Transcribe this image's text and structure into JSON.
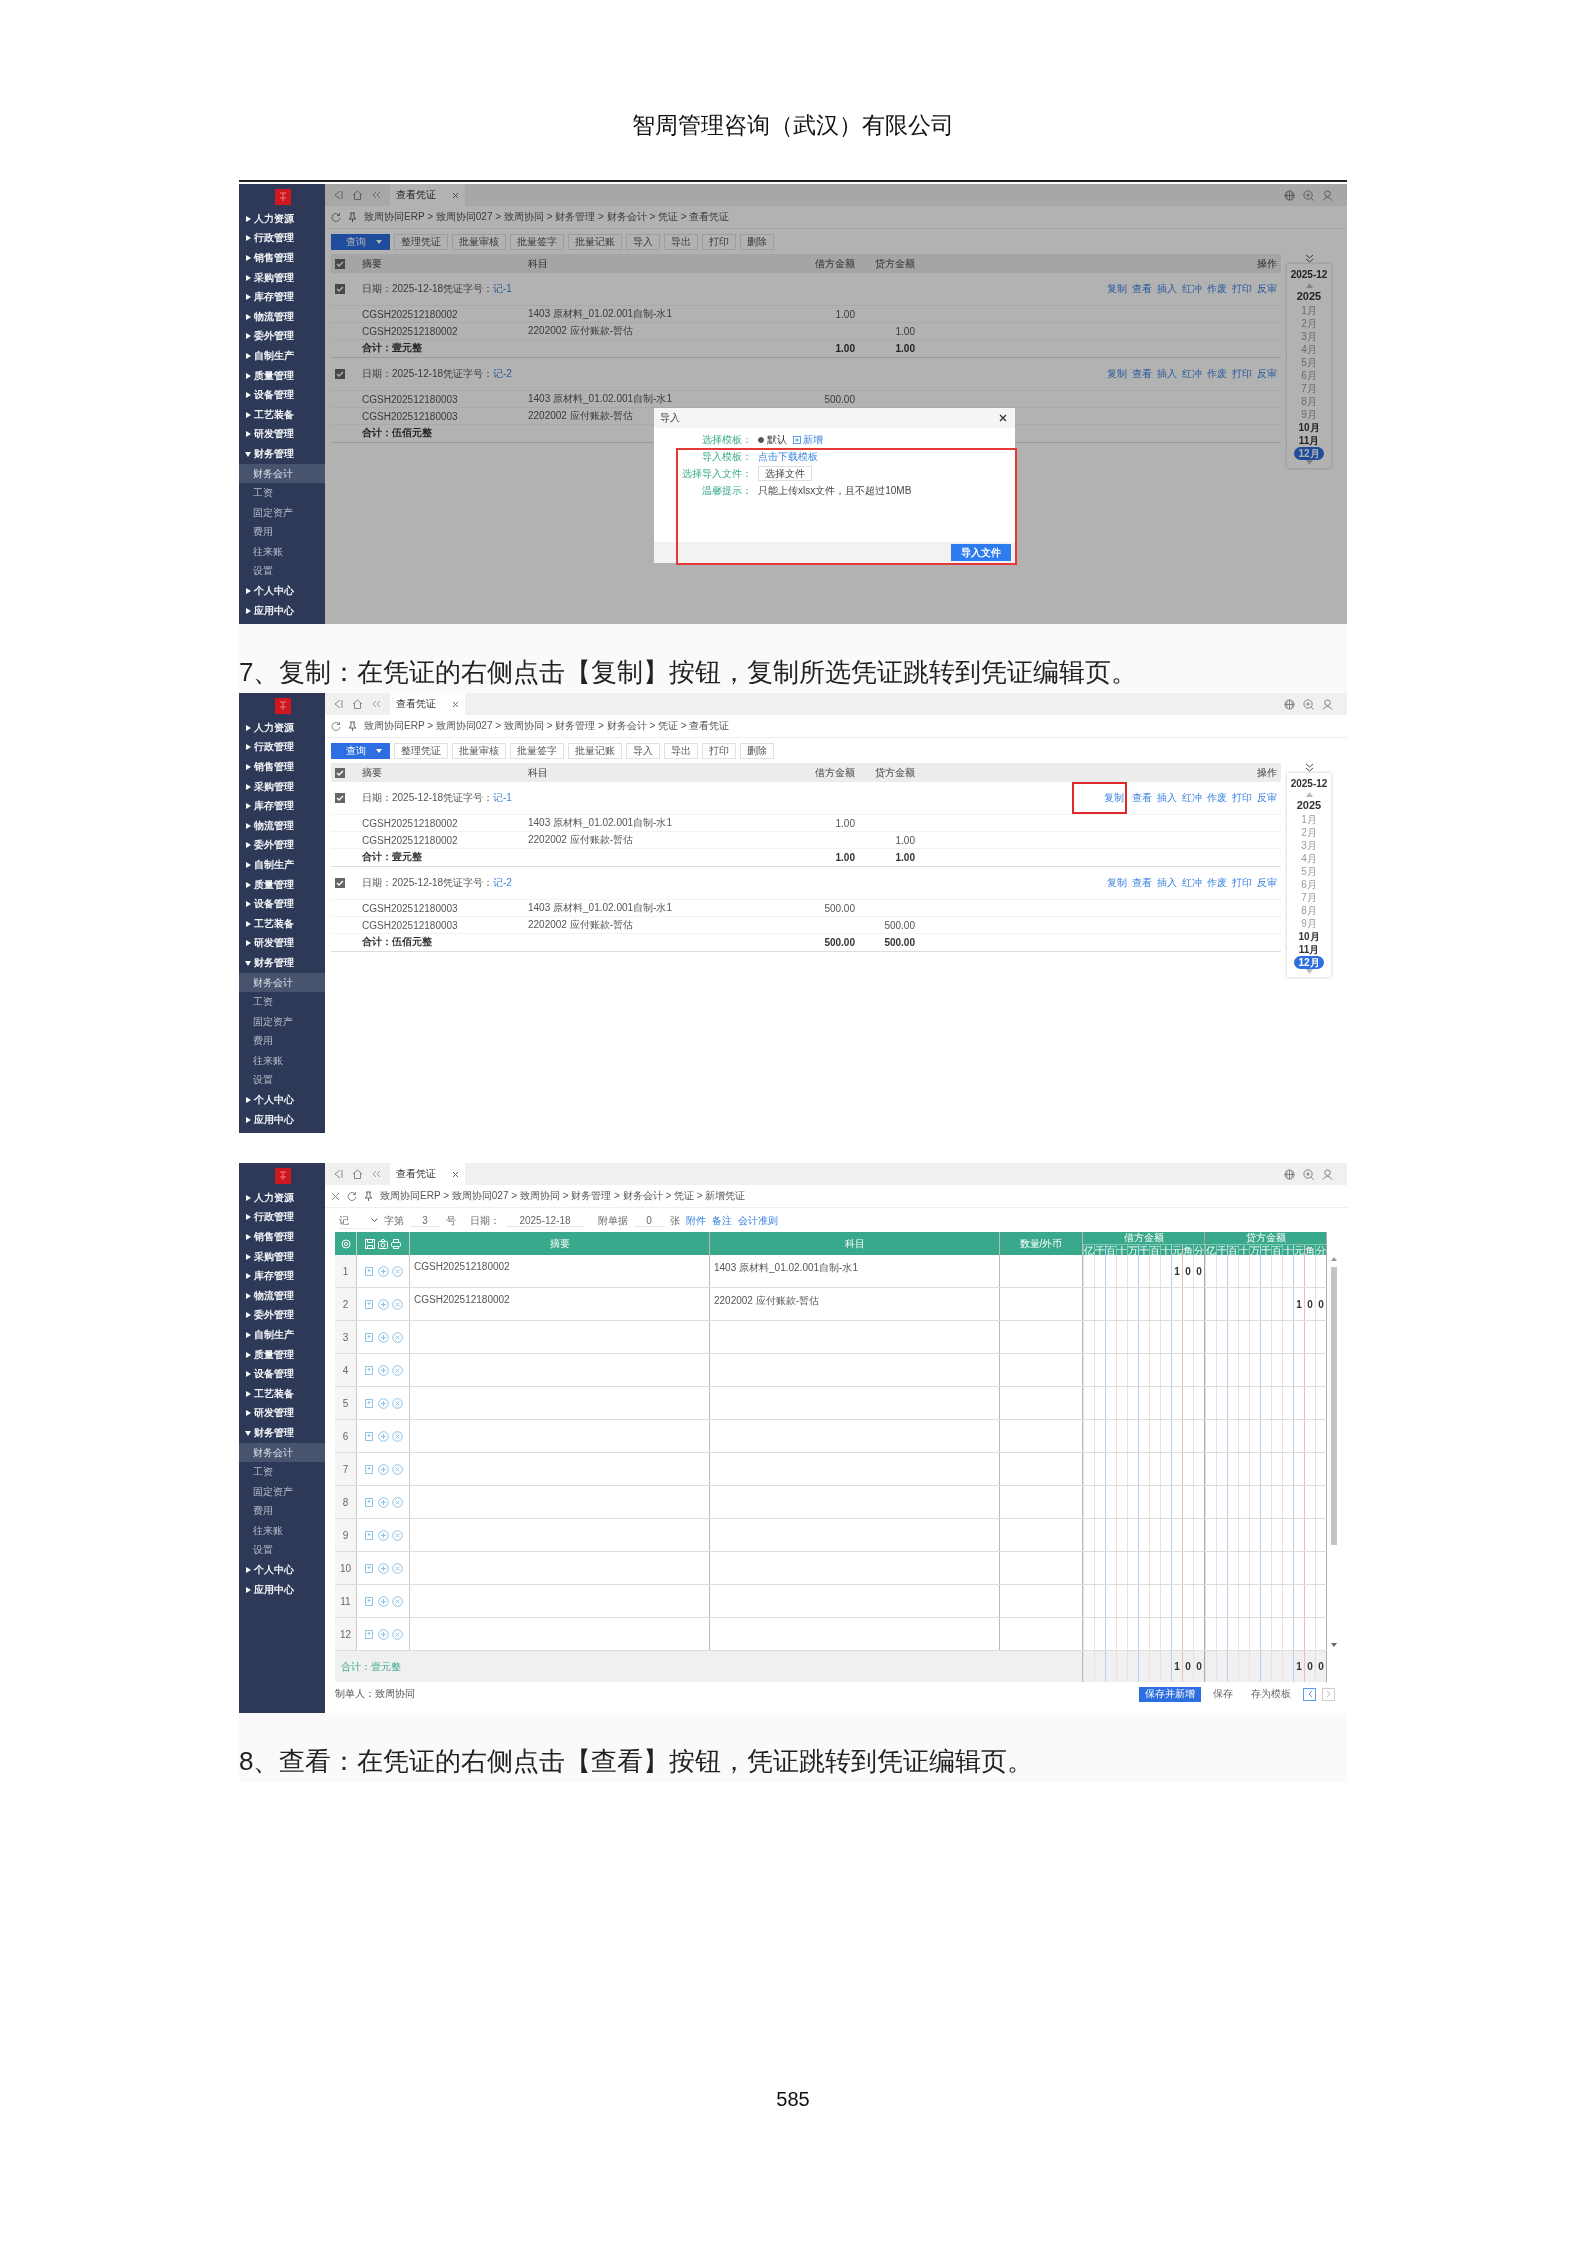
{
  "header": {
    "company": "智周管理咨询（武汉）有限公司"
  },
  "blocks": [
    {
      "kind": "screenshot",
      "screen": {
        "kind": "voucher_list",
        "sidebar": [
          {
            "label": "人力资源",
            "expanded": false
          },
          {
            "label": "行政管理",
            "expanded": false
          },
          {
            "label": "销售管理",
            "expanded": false
          },
          {
            "label": "采购管理",
            "expanded": false
          },
          {
            "label": "库存管理",
            "expanded": false
          },
          {
            "label": "物流管理",
            "expanded": false
          },
          {
            "label": "委外管理",
            "expanded": false
          },
          {
            "label": "自制生产",
            "expanded": false
          },
          {
            "label": "质量管理",
            "expanded": false
          },
          {
            "label": "设备管理",
            "expanded": false
          },
          {
            "label": "工艺装备",
            "expanded": false
          },
          {
            "label": "研发管理",
            "expanded": false
          },
          {
            "label": "财务管理",
            "expanded": true,
            "children": [
              {
                "label": "财务会计",
                "selected": true
              },
              {
                "label": "工资",
                "selected": false
              },
              {
                "label": "固定资产",
                "selected": false
              },
              {
                "label": "费用",
                "selected": false
              },
              {
                "label": "往来账",
                "selected": false
              },
              {
                "label": "设置",
                "selected": false
              }
            ]
          },
          {
            "label": "个人中心",
            "expanded": false
          },
          {
            "label": "应用中心",
            "expanded": false
          }
        ],
        "tabs": [
          {
            "label": "查看凭证",
            "selected": true
          }
        ],
        "breadcrumb": "致周协同ERP > 致周协同027 > 致周协同 > 财务管理 > 财务会计 > 凭证 > 查看凭证",
        "toolbar": [
          {
            "label": "查询",
            "kind": "primary"
          },
          {
            "label": "整理凭证",
            "kind": "plain"
          },
          {
            "label": "批量审核",
            "kind": "plain"
          },
          {
            "label": "批量签字",
            "kind": "plain"
          },
          {
            "label": "批量记账",
            "kind": "plain"
          },
          {
            "label": "导入",
            "kind": "plain"
          },
          {
            "label": "导出",
            "kind": "plain"
          },
          {
            "label": "打印",
            "kind": "plain"
          },
          {
            "label": "删除",
            "kind": "plain"
          }
        ],
        "header_checked": true,
        "columns": [
          "摘要",
          "科目",
          "借方金额",
          "贷方金额",
          "操作"
        ],
        "vouchers": [
          {
            "checked": true,
            "date": "日期：2025-12-18",
            "number_label": "凭证字号：",
            "number": "记-1",
            "actions": [
              {
                "label": "复制",
                "highlighted": false
              },
              {
                "label": "查看",
                "highlighted": false
              },
              {
                "label": "插入",
                "highlighted": false
              },
              {
                "label": "红冲",
                "highlighted": false
              },
              {
                "label": "作废",
                "highlighted": false
              },
              {
                "label": "打印",
                "highlighted": false
              },
              {
                "label": "反审",
                "highlighted": false
              }
            ],
            "entries": [
              {
                "summary": "CGSH202512180002",
                "account": "1403 原材料_01.02.001自制-水1",
                "debit": "1.00"
              },
              {
                "summary": "CGSH202512180002",
                "account": "2202002 应付账款-暂估",
                "credit": "1.00"
              }
            ],
            "total": {
              "label": "合计：壹元整",
              "debit": "1.00",
              "credit": "1.00"
            }
          },
          {
            "checked": true,
            "date": "日期：2025-12-18",
            "number_label": "凭证字号：",
            "number": "记-2",
            "actions": [
              {
                "label": "复制",
                "highlighted": false
              },
              {
                "label": "查看",
                "highlighted": false
              },
              {
                "label": "插入",
                "highlighted": false
              },
              {
                "label": "红冲",
                "highlighted": false
              },
              {
                "label": "作废",
                "highlighted": false
              },
              {
                "label": "打印",
                "highlighted": false
              },
              {
                "label": "反审",
                "highlighted": false
              }
            ],
            "entries": [
              {
                "summary": "CGSH202512180003",
                "account": "1403 原材料_01.02.001自制-水1",
                "debit": "500.00"
              },
              {
                "summary": "CGSH202512180003",
                "account": "2202002 应付账款-暂估"
              }
            ],
            "total": {
              "label": "合计：伍佰元整"
            }
          }
        ],
        "month_picker": {
          "current": "2025-12",
          "year": "2025",
          "months": [
            {
              "label": "1月",
              "selected": false,
              "has_entries": false
            },
            {
              "label": "2月",
              "selected": false,
              "has_entries": false
            },
            {
              "label": "3月",
              "selected": false,
              "has_entries": false
            },
            {
              "label": "4月",
              "selected": false,
              "has_entries": false
            },
            {
              "label": "5月",
              "selected": false,
              "has_entries": false
            },
            {
              "label": "6月",
              "selected": false,
              "has_entries": false
            },
            {
              "label": "7月",
              "selected": false,
              "has_entries": false
            },
            {
              "label": "8月",
              "selected": false,
              "has_entries": false
            },
            {
              "label": "9月",
              "selected": false,
              "has_entries": false
            },
            {
              "label": "10月",
              "selected": false,
              "has_entries": true
            },
            {
              "label": "11月",
              "selected": false,
              "has_entries": true
            },
            {
              "label": "12月",
              "selected": true,
              "has_entries": true
            }
          ]
        },
        "dialog": {
          "title": "导入",
          "highlighted": true,
          "rows": [
            {
              "label": "选择模板：",
              "kind": "radio",
              "option": "默认",
              "checked": true,
              "link": "新增"
            },
            {
              "label": "导入模板：",
              "kind": "link",
              "value": "点击下载模板"
            },
            {
              "label": "选择导入文件：",
              "kind": "file",
              "value": "选择文件"
            },
            {
              "label": "温馨提示：",
              "kind": "text",
              "value": "只能上传xlsx文件，且不超过10MB"
            }
          ],
          "button": "导入文件"
        }
      }
    },
    {
      "kind": "caption",
      "text": "7、复制：在凭证的右侧点击【复制】按钮，复制所选凭证跳转到凭证编辑页。"
    },
    {
      "kind": "screenshot",
      "screen": {
        "kind": "voucher_list",
        "sidebar": [
          {
            "label": "人力资源",
            "expanded": false
          },
          {
            "label": "行政管理",
            "expanded": false
          },
          {
            "label": "销售管理",
            "expanded": false
          },
          {
            "label": "采购管理",
            "expanded": false
          },
          {
            "label": "库存管理",
            "expanded": false
          },
          {
            "label": "物流管理",
            "expanded": false
          },
          {
            "label": "委外管理",
            "expanded": false
          },
          {
            "label": "自制生产",
            "expanded": false
          },
          {
            "label": "质量管理",
            "expanded": false
          },
          {
            "label": "设备管理",
            "expanded": false
          },
          {
            "label": "工艺装备",
            "expanded": false
          },
          {
            "label": "研发管理",
            "expanded": false
          },
          {
            "label": "财务管理",
            "expanded": true,
            "children": [
              {
                "label": "财务会计",
                "selected": true
              },
              {
                "label": "工资",
                "selected": false
              },
              {
                "label": "固定资产",
                "selected": false
              },
              {
                "label": "费用",
                "selected": false
              },
              {
                "label": "往来账",
                "selected": false
              },
              {
                "label": "设置",
                "selected": false
              }
            ]
          },
          {
            "label": "个人中心",
            "expanded": false
          },
          {
            "label": "应用中心",
            "expanded": false
          }
        ],
        "tabs": [
          {
            "label": "查看凭证",
            "selected": true
          }
        ],
        "breadcrumb": "致周协同ERP > 致周协同027 > 致周协同 > 财务管理 > 财务会计 > 凭证 > 查看凭证",
        "toolbar": [
          {
            "label": "查询",
            "kind": "primary"
          },
          {
            "label": "整理凭证",
            "kind": "plain"
          },
          {
            "label": "批量审核",
            "kind": "plain"
          },
          {
            "label": "批量签字",
            "kind": "plain"
          },
          {
            "label": "批量记账",
            "kind": "plain"
          },
          {
            "label": "导入",
            "kind": "plain"
          },
          {
            "label": "导出",
            "kind": "plain"
          },
          {
            "label": "打印",
            "kind": "plain"
          },
          {
            "label": "删除",
            "kind": "plain"
          }
        ],
        "header_checked": true,
        "columns": [
          "摘要",
          "科目",
          "借方金额",
          "贷方金额",
          "操作"
        ],
        "vouchers": [
          {
            "checked": true,
            "date": "日期：2025-12-18",
            "number_label": "凭证字号：",
            "number": "记-1",
            "actions": [
              {
                "label": "复制",
                "highlighted": true
              },
              {
                "label": "查看",
                "highlighted": false
              },
              {
                "label": "插入",
                "highlighted": false
              },
              {
                "label": "红冲",
                "highlighted": false
              },
              {
                "label": "作废",
                "highlighted": false
              },
              {
                "label": "打印",
                "highlighted": false
              },
              {
                "label": "反审",
                "highlighted": false
              }
            ],
            "entries": [
              {
                "summary": "CGSH202512180002",
                "account": "1403 原材料_01.02.001自制-水1",
                "debit": "1.00"
              },
              {
                "summary": "CGSH202512180002",
                "account": "2202002 应付账款-暂估",
                "credit": "1.00"
              }
            ],
            "total": {
              "label": "合计：壹元整",
              "debit": "1.00",
              "credit": "1.00"
            }
          },
          {
            "checked": true,
            "date": "日期：2025-12-18",
            "number_label": "凭证字号：",
            "number": "记-2",
            "actions": [
              {
                "label": "复制",
                "highlighted": false
              },
              {
                "label": "查看",
                "highlighted": false
              },
              {
                "label": "插入",
                "highlighted": false
              },
              {
                "label": "红冲",
                "highlighted": false
              },
              {
                "label": "作废",
                "highlighted": false
              },
              {
                "label": "打印",
                "highlighted": false
              },
              {
                "label": "反审",
                "highlighted": false
              }
            ],
            "entries": [
              {
                "summary": "CGSH202512180003",
                "account": "1403 原材料_01.02.001自制-水1",
                "debit": "500.00"
              },
              {
                "summary": "CGSH202512180003",
                "account": "2202002 应付账款-暂估",
                "credit": "500.00"
              }
            ],
            "total": {
              "label": "合计：伍佰元整",
              "debit": "500.00",
              "credit": "500.00"
            }
          }
        ],
        "month_picker": {
          "current": "2025-12",
          "year": "2025",
          "months": [
            {
              "label": "1月",
              "selected": false,
              "has_entries": false
            },
            {
              "label": "2月",
              "selected": false,
              "has_entries": false
            },
            {
              "label": "3月",
              "selected": false,
              "has_entries": false
            },
            {
              "label": "4月",
              "selected": false,
              "has_entries": false
            },
            {
              "label": "5月",
              "selected": false,
              "has_entries": false
            },
            {
              "label": "6月",
              "selected": false,
              "has_entries": false
            },
            {
              "label": "7月",
              "selected": false,
              "has_entries": false
            },
            {
              "label": "8月",
              "selected": false,
              "has_entries": false
            },
            {
              "label": "9月",
              "selected": false,
              "has_entries": false
            },
            {
              "label": "10月",
              "selected": false,
              "has_entries": true
            },
            {
              "label": "11月",
              "selected": false,
              "has_entries": true
            },
            {
              "label": "12月",
              "selected": true,
              "has_entries": true
            }
          ]
        }
      }
    },
    {
      "kind": "screenshot",
      "screen": {
        "kind": "voucher_edit",
        "sidebar": [
          {
            "label": "人力资源",
            "expanded": false
          },
          {
            "label": "行政管理",
            "expanded": false
          },
          {
            "label": "销售管理",
            "expanded": false
          },
          {
            "label": "采购管理",
            "expanded": false
          },
          {
            "label": "库存管理",
            "expanded": false
          },
          {
            "label": "物流管理",
            "expanded": false
          },
          {
            "label": "委外管理",
            "expanded": false
          },
          {
            "label": "自制生产",
            "expanded": false
          },
          {
            "label": "质量管理",
            "expanded": false
          },
          {
            "label": "设备管理",
            "expanded": false
          },
          {
            "label": "工艺装备",
            "expanded": false
          },
          {
            "label": "研发管理",
            "expanded": false
          },
          {
            "label": "财务管理",
            "expanded": true,
            "children": [
              {
                "label": "财务会计",
                "selected": true
              },
              {
                "label": "工资",
                "selected": false
              },
              {
                "label": "固定资产",
                "selected": false
              },
              {
                "label": "费用",
                "selected": false
              },
              {
                "label": "往来账",
                "selected": false
              },
              {
                "label": "设置",
                "selected": false
              }
            ]
          },
          {
            "label": "个人中心",
            "expanded": false
          },
          {
            "label": "应用中心",
            "expanded": false
          }
        ],
        "tabs": [
          {
            "label": "查看凭证",
            "selected": true
          }
        ],
        "breadcrumb": "致周协同ERP > 致周协同027 > 致周协同 > 财务管理 > 财务会计 > 凭证 > 新增凭证",
        "form": {
          "voucher_type": "记",
          "word_label": "字第",
          "number": "3",
          "number_suffix": "号",
          "date_label": "日期：",
          "date": "2025-12-18",
          "attach_label": "附单据",
          "attach_count": "0",
          "attach_suffix": "张",
          "links": [
            "附件",
            "备注",
            "会计准则"
          ]
        },
        "grid": {
          "columns": [
            "摘要",
            "科目",
            "数量/外币"
          ],
          "debit_title": "借方金额",
          "credit_title": "贷方金额",
          "debit_digits": [
            "亿",
            "千",
            "百",
            "十",
            "万",
            "千",
            "百",
            "十",
            "元",
            "角",
            "分"
          ],
          "credit_digits": [
            "亿",
            "千",
            "百",
            "十",
            "万",
            "千",
            "百",
            "十",
            "元",
            "角",
            "分"
          ],
          "rows": [
            {
              "no": "1",
              "summary": "CGSH202512180002",
              "account": "1403 原材料_01.02.001自制-水1",
              "debit": "1 0 0"
            },
            {
              "no": "2",
              "summary": "CGSH202512180002",
              "account": "2202002 应付账款-暂估",
              "credit": "1 0 0"
            },
            {
              "no": "3"
            },
            {
              "no": "4"
            },
            {
              "no": "5"
            },
            {
              "no": "6"
            },
            {
              "no": "7"
            },
            {
              "no": "8"
            },
            {
              "no": "9"
            },
            {
              "no": "10"
            },
            {
              "no": "11"
            },
            {
              "no": "12"
            }
          ],
          "total": {
            "label": "合计：壹元整",
            "debit": "1 0 0",
            "credit": "1 0 0"
          }
        },
        "footer": {
          "creator": "制单人：致周协同",
          "buttons": [
            {
              "label": "保存并新增",
              "kind": "primary"
            },
            {
              "label": "保存",
              "kind": "plain"
            },
            {
              "label": "存为模板",
              "kind": "plain"
            }
          ]
        }
      }
    },
    {
      "kind": "caption",
      "text": "8、查看：在凭证的右侧点击【查看】按钮，凭证跳转到凭证编辑页。"
    }
  ],
  "page_number": "585"
}
